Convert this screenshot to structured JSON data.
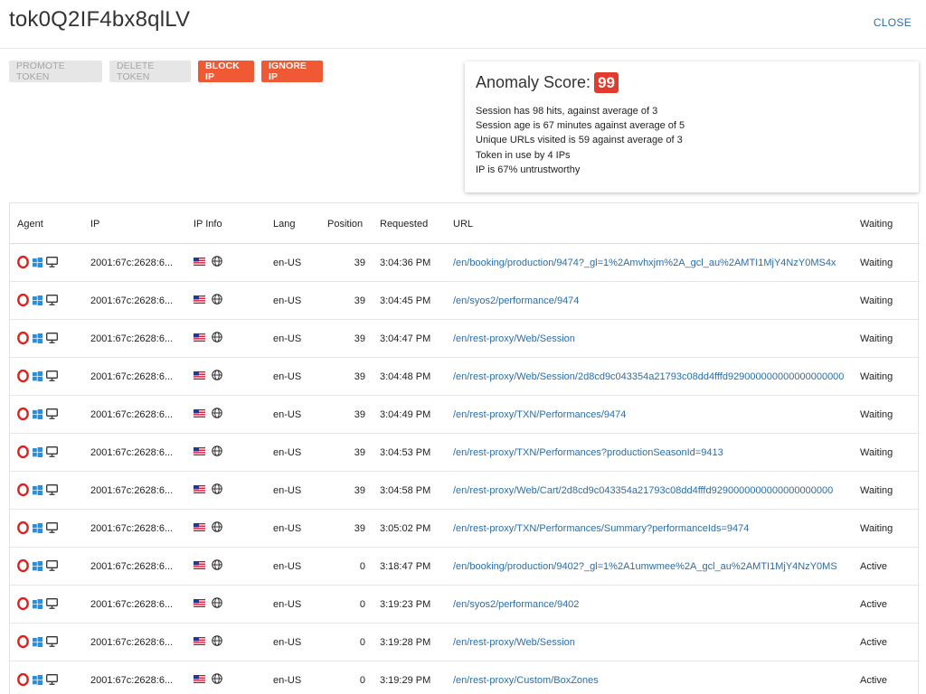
{
  "header": {
    "title": "tok0Q2IF4bx8qlLV",
    "close_label": "CLOSE"
  },
  "actions": {
    "promote_label": "PROMOTE TOKEN",
    "delete_label": "DELETE TOKEN",
    "block_ip_label": "BLOCK IP",
    "ignore_ip_label": "IGNORE IP"
  },
  "anomaly": {
    "label": "Anomaly Score:",
    "score": "99",
    "details": [
      "Session has 98 hits, against average of 3",
      "Session age is 67 minutes against average of 5",
      "Unique URLs visited is 59 against average of 3",
      "Token in use by 4 IPs",
      "IP is 67% untrustworthy"
    ]
  },
  "table": {
    "headers": {
      "agent": "Agent",
      "ip": "IP",
      "ip_info": "IP Info",
      "lang": "Lang",
      "position": "Position",
      "requested": "Requested",
      "url": "URL",
      "waiting": "Waiting"
    },
    "rows": [
      {
        "ip": "2001:67c:2628:6...",
        "lang": "en-US",
        "position": "39",
        "requested": "3:04:36 PM",
        "url": "/en/booking/production/9474?_gl=1%2Amvhxjm%2A_gcl_au%2AMTI1MjY4NzY0MS4x",
        "status": "Waiting"
      },
      {
        "ip": "2001:67c:2628:6...",
        "lang": "en-US",
        "position": "39",
        "requested": "3:04:45 PM",
        "url": "/en/syos2/performance/9474",
        "status": "Waiting"
      },
      {
        "ip": "2001:67c:2628:6...",
        "lang": "en-US",
        "position": "39",
        "requested": "3:04:47 PM",
        "url": "/en/rest-proxy/Web/Session",
        "status": "Waiting"
      },
      {
        "ip": "2001:67c:2628:6...",
        "lang": "en-US",
        "position": "39",
        "requested": "3:04:48 PM",
        "url": "/en/rest-proxy/Web/Session/2d8cd9c043354a21793c08dd4fffd929000000000000000000",
        "status": "Waiting"
      },
      {
        "ip": "2001:67c:2628:6...",
        "lang": "en-US",
        "position": "39",
        "requested": "3:04:49 PM",
        "url": "/en/rest-proxy/TXN/Performances/9474",
        "status": "Waiting"
      },
      {
        "ip": "2001:67c:2628:6...",
        "lang": "en-US",
        "position": "39",
        "requested": "3:04:53 PM",
        "url": "/en/rest-proxy/TXN/Performances?productionSeasonId=9413",
        "status": "Waiting"
      },
      {
        "ip": "2001:67c:2628:6...",
        "lang": "en-US",
        "position": "39",
        "requested": "3:04:58 PM",
        "url": "/en/rest-proxy/Web/Cart/2d8cd9c043354a21793c08dd4fffd9290000000000000000000",
        "status": "Waiting"
      },
      {
        "ip": "2001:67c:2628:6...",
        "lang": "en-US",
        "position": "39",
        "requested": "3:05:02 PM",
        "url": "/en/rest-proxy/TXN/Performances/Summary?performanceIds=9474",
        "status": "Waiting"
      },
      {
        "ip": "2001:67c:2628:6...",
        "lang": "en-US",
        "position": "0",
        "requested": "3:18:47 PM",
        "url": "/en/booking/production/9402?_gl=1%2A1umwmee%2A_gcl_au%2AMTI1MjY4NzY0MS",
        "status": "Active"
      },
      {
        "ip": "2001:67c:2628:6...",
        "lang": "en-US",
        "position": "0",
        "requested": "3:19:23 PM",
        "url": "/en/syos2/performance/9402",
        "status": "Active"
      },
      {
        "ip": "2001:67c:2628:6...",
        "lang": "en-US",
        "position": "0",
        "requested": "3:19:28 PM",
        "url": "/en/rest-proxy/Web/Session",
        "status": "Active"
      },
      {
        "ip": "2001:67c:2628:6...",
        "lang": "en-US",
        "position": "0",
        "requested": "3:19:29 PM",
        "url": "/en/rest-proxy/Custom/BoxZones",
        "status": "Active"
      }
    ]
  },
  "icons": {
    "agent": [
      "opera-icon",
      "windows-icon",
      "desktop-icon"
    ],
    "ip_info": [
      "us-flag-icon",
      "globe-icon"
    ]
  },
  "colors": {
    "accent_link": "#2a6ea8",
    "danger_button": "#ef5a35",
    "score_badge": "#e23b2e",
    "opera_red": "#e0201c",
    "windows_blue": "#2c8ed6"
  }
}
